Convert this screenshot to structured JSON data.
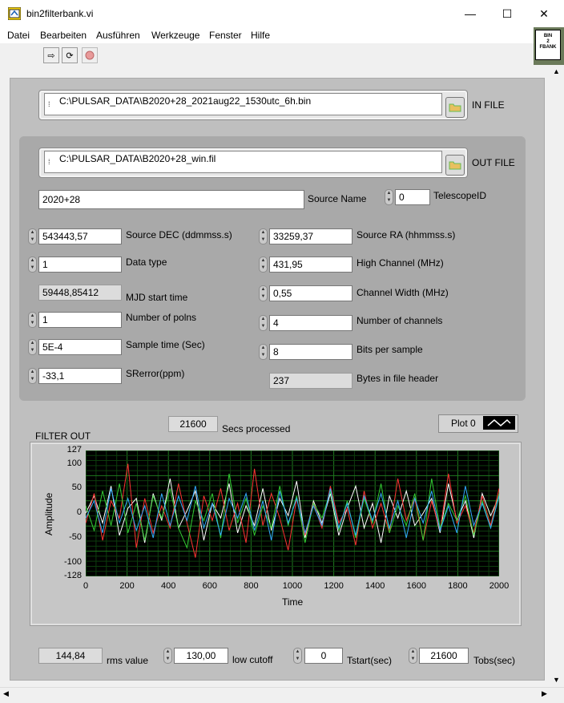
{
  "window": {
    "title": "bin2filterbank.vi",
    "controls": {
      "minimize": "—",
      "maximize": "☐",
      "close": "✕"
    }
  },
  "menu": [
    "Datei",
    "Bearbeiten",
    "Ausführen",
    "Werkzeuge",
    "Fenster",
    "Hilfe"
  ],
  "vi_icon": {
    "lines": [
      "BIN",
      "2",
      "FBANK"
    ]
  },
  "in_file": {
    "path": "C:\\PULSAR_DATA\\B2020+28_2021aug22_1530utc_6h.bin",
    "label": "IN FILE"
  },
  "out_file": {
    "path": "C:\\PULSAR_DATA\\B2020+28_win.fil",
    "label": "OUT FILE"
  },
  "header": {
    "source_name": {
      "value": "2020+28",
      "label": "Source Name"
    },
    "telescope_id": {
      "value": "0",
      "label": "TelescopeID"
    },
    "source_dec": {
      "value": "543443,57",
      "label": "Source DEC (ddmmss.s)"
    },
    "source_ra": {
      "value": "33259,37",
      "label": "Source RA (hhmmss.s)"
    },
    "data_type": {
      "value": "1",
      "label": "Data type"
    },
    "high_channel": {
      "value": "431,95",
      "label": "High Channel (MHz)"
    },
    "mjd_start": {
      "value": "59448,85412",
      "label": "MJD start time"
    },
    "channel_width": {
      "value": "0,55",
      "label": "Channel Width (MHz)"
    },
    "num_polns": {
      "value": "1",
      "label": "Number of polns"
    },
    "num_channels": {
      "value": "4",
      "label": "Number of channels"
    },
    "sample_time": {
      "value": "5E-4",
      "label": "Sample time (Sec)"
    },
    "bits_per_sample": {
      "value": "8",
      "label": "Bits per sample"
    },
    "srerror": {
      "value": "-33,1",
      "label": "SRerror(ppm)"
    },
    "bytes_header": {
      "value": "237",
      "label": "Bytes in file header"
    }
  },
  "secs_processed": {
    "value": "21600",
    "label": "Secs processed"
  },
  "graph": {
    "label": "FILTER OUT",
    "legend": "Plot 0"
  },
  "chart_data": {
    "type": "line",
    "title": "",
    "xlabel": "Time",
    "ylabel": "Amplitude",
    "xlim": [
      0,
      2000
    ],
    "ylim": [
      -128,
      127
    ],
    "x_ticks": [
      "0",
      "200",
      "400",
      "600",
      "800",
      "1000",
      "1200",
      "1400",
      "1600",
      "1800",
      "2000"
    ],
    "y_ticks": [
      "127",
      "100",
      "50",
      "0",
      "-50",
      "-100",
      "-128"
    ],
    "grid": true,
    "series": [
      {
        "color": "#ffffff",
        "values": [
          0,
          35,
          -20,
          55,
          -45,
          10,
          30,
          -60,
          40,
          -15,
          70,
          -30,
          5,
          45,
          -55,
          20,
          -10,
          60,
          -40,
          15,
          -25,
          50,
          -35,
          30,
          -5,
          65,
          -50,
          25,
          -20,
          40,
          -45,
          10,
          55,
          -30,
          20,
          -60,
          35,
          -10,
          45,
          -25,
          0,
          30,
          -40,
          60,
          -15,
          25,
          -50,
          40,
          -5,
          35
        ]
      },
      {
        "color": "#ff3333",
        "values": [
          -20,
          40,
          -55,
          25,
          -10,
          100,
          -70,
          30,
          -40,
          15,
          -30,
          60,
          -20,
          -90,
          35,
          -15,
          50,
          -35,
          20,
          -60,
          90,
          -25,
          40,
          -10,
          -75,
          30,
          -45,
          20,
          -30,
          55,
          -20,
          10,
          -65,
          45,
          -30,
          20,
          -40,
          70,
          -15,
          30,
          -55,
          25,
          -35,
          80,
          -20,
          15,
          -40,
          35,
          -25,
          50
        ]
      },
      {
        "color": "#33cc33",
        "values": [
          15,
          -35,
          45,
          -25,
          60,
          -40,
          20,
          -55,
          35,
          -10,
          50,
          -30,
          -70,
          25,
          -15,
          40,
          -50,
          80,
          -20,
          30,
          -45,
          15,
          -30,
          55,
          -25,
          35,
          -60,
          20,
          -10,
          45,
          -35,
          25,
          -50,
          30,
          -20,
          60,
          -40,
          15,
          -25,
          40,
          -55,
          70,
          -30,
          20,
          -15,
          35,
          -45,
          25,
          -30,
          40
        ]
      },
      {
        "color": "#33aaff",
        "values": [
          -10,
          25,
          -40,
          50,
          -20,
          30,
          -35,
          15,
          -50,
          40,
          -25,
          35,
          -15,
          55,
          -30,
          20,
          -45,
          30,
          -10,
          40,
          -35,
          25,
          -55,
          45,
          -20,
          30,
          -40,
          15,
          -25,
          50,
          -30,
          20,
          -45,
          35,
          -15,
          40,
          -30,
          25,
          -50,
          30,
          -20,
          45,
          -35,
          15,
          -40,
          55,
          -25,
          20,
          -30,
          35
        ]
      }
    ]
  },
  "bottom": {
    "rms": {
      "value": "144,84",
      "label": "rms value"
    },
    "low_cutoff": {
      "value": "130,00",
      "label": "low cutoff"
    },
    "tstart": {
      "value": "0",
      "label": "Tstart(sec)"
    },
    "tobs": {
      "value": "21600",
      "label": "Tobs(sec)"
    }
  }
}
